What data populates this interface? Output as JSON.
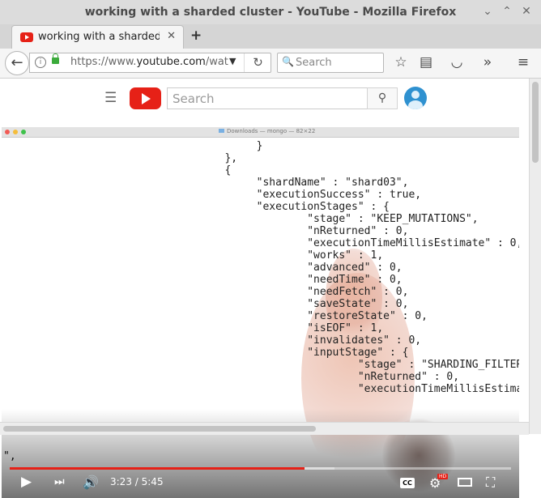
{
  "window": {
    "title": "working with a sharded cluster - YouTube - Mozilla Firefox"
  },
  "tab": {
    "title": "working with a sharded cl",
    "favicon": "youtube-icon"
  },
  "navbar": {
    "url_prefix": "https://www.",
    "url_domain": "youtube.com",
    "url_suffix": "/watch?v",
    "search_placeholder": "Search"
  },
  "youtube": {
    "search_placeholder": "Search"
  },
  "terminal": {
    "window_title": "Downloads — mongo — 82×22",
    "lines": [
      "        }",
      "   },",
      "   {",
      "        \"shardName\" : \"shard03\",",
      "        \"executionSuccess\" : true,",
      "        \"executionStages\" : {",
      "                \"stage\" : \"KEEP_MUTATIONS\",",
      "                \"nReturned\" : 0,",
      "                \"executionTimeMillisEstimate\" : 0,",
      "                \"works\" : 1,",
      "                \"advanced\" : 0,",
      "                \"needTime\" : 0,",
      "                \"needFetch\" : 0,",
      "                \"saveState\" : 0,",
      "                \"restoreState\" : 0,",
      "                \"isEOF\" : 1,",
      "                \"invalidates\" : 0,",
      "                \"inputStage\" : {",
      "                        \"stage\" : \"SHARDING_FILTER",
      "                        \"nReturned\" : 0,",
      "                        \"executionTimeMillisEstimat"
    ],
    "stray_text": "\","
  },
  "player": {
    "current_time": "3:23",
    "separator": " / ",
    "duration": "5:45",
    "progress": 0.588,
    "hd_badge": "HD",
    "cc_label": "CC"
  }
}
